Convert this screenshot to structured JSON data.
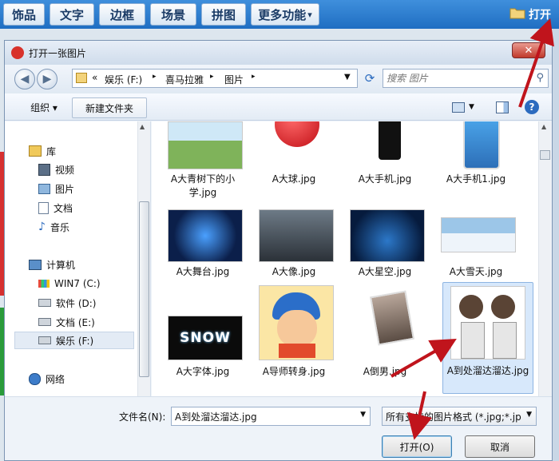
{
  "top_toolbar": {
    "tabs": [
      "饰品",
      "文字",
      "边框",
      "场景",
      "拼图",
      "更多功能"
    ],
    "more_chevron": "▾",
    "open_label": "打开"
  },
  "dialog": {
    "title": "打开一张图片",
    "close_glyph": "✕",
    "breadcrumb": {
      "prefix": "«",
      "parts": [
        "娱乐 (F:)",
        "喜马拉雅",
        "图片"
      ],
      "separator": "▸"
    },
    "search_placeholder": "搜索 图片",
    "organize_label": "组织 ▾",
    "new_folder_label": "新建文件夹",
    "sidebar": {
      "library_label": "库",
      "library_items": [
        "视频",
        "图片",
        "文档",
        "音乐"
      ],
      "computer_label": "计算机",
      "drives": [
        "WIN7 (C:)",
        "软件 (D:)",
        "文档 (E:)",
        "娱乐 (F:)"
      ],
      "network_label": "网络"
    },
    "files": [
      {
        "name": "A大青树下的小学.jpg",
        "thumb": "village"
      },
      {
        "name": "A大球.jpg",
        "thumb": "red-ball"
      },
      {
        "name": "A大手机.jpg",
        "thumb": "phone"
      },
      {
        "name": "A大手机1.jpg",
        "thumb": "phone-apps"
      },
      {
        "name": "A大舞台.jpg",
        "thumb": "stage"
      },
      {
        "name": "A大像.jpg",
        "thumb": "elephant"
      },
      {
        "name": "A大星空.jpg",
        "thumb": "starry-sky"
      },
      {
        "name": "A大雪天.jpg",
        "thumb": "snow-scene"
      },
      {
        "name": "A大字体.jpg",
        "thumb": "snow-text",
        "thumb_text": "SNOW"
      },
      {
        "name": "A导师转身.jpg",
        "thumb": "cartoon-boy"
      },
      {
        "name": "A倒男.jpg",
        "thumb": "upside-down-photo"
      },
      {
        "name": "A到处溜达溜达.jpg",
        "thumb": "cartoon-pair",
        "selected": true
      }
    ],
    "filename_label": "文件名(N):",
    "filename_value": "A到处溜达溜达.jpg",
    "filetype_value": "所有支持的图片格式 (*.jpg;*.jp",
    "open_button": "打开(O)",
    "cancel_button": "取消"
  },
  "colors": {
    "toolbar_blue": "#2a7bd0",
    "arrow_red": "#c0141c",
    "selection": "#d7e8fb"
  }
}
